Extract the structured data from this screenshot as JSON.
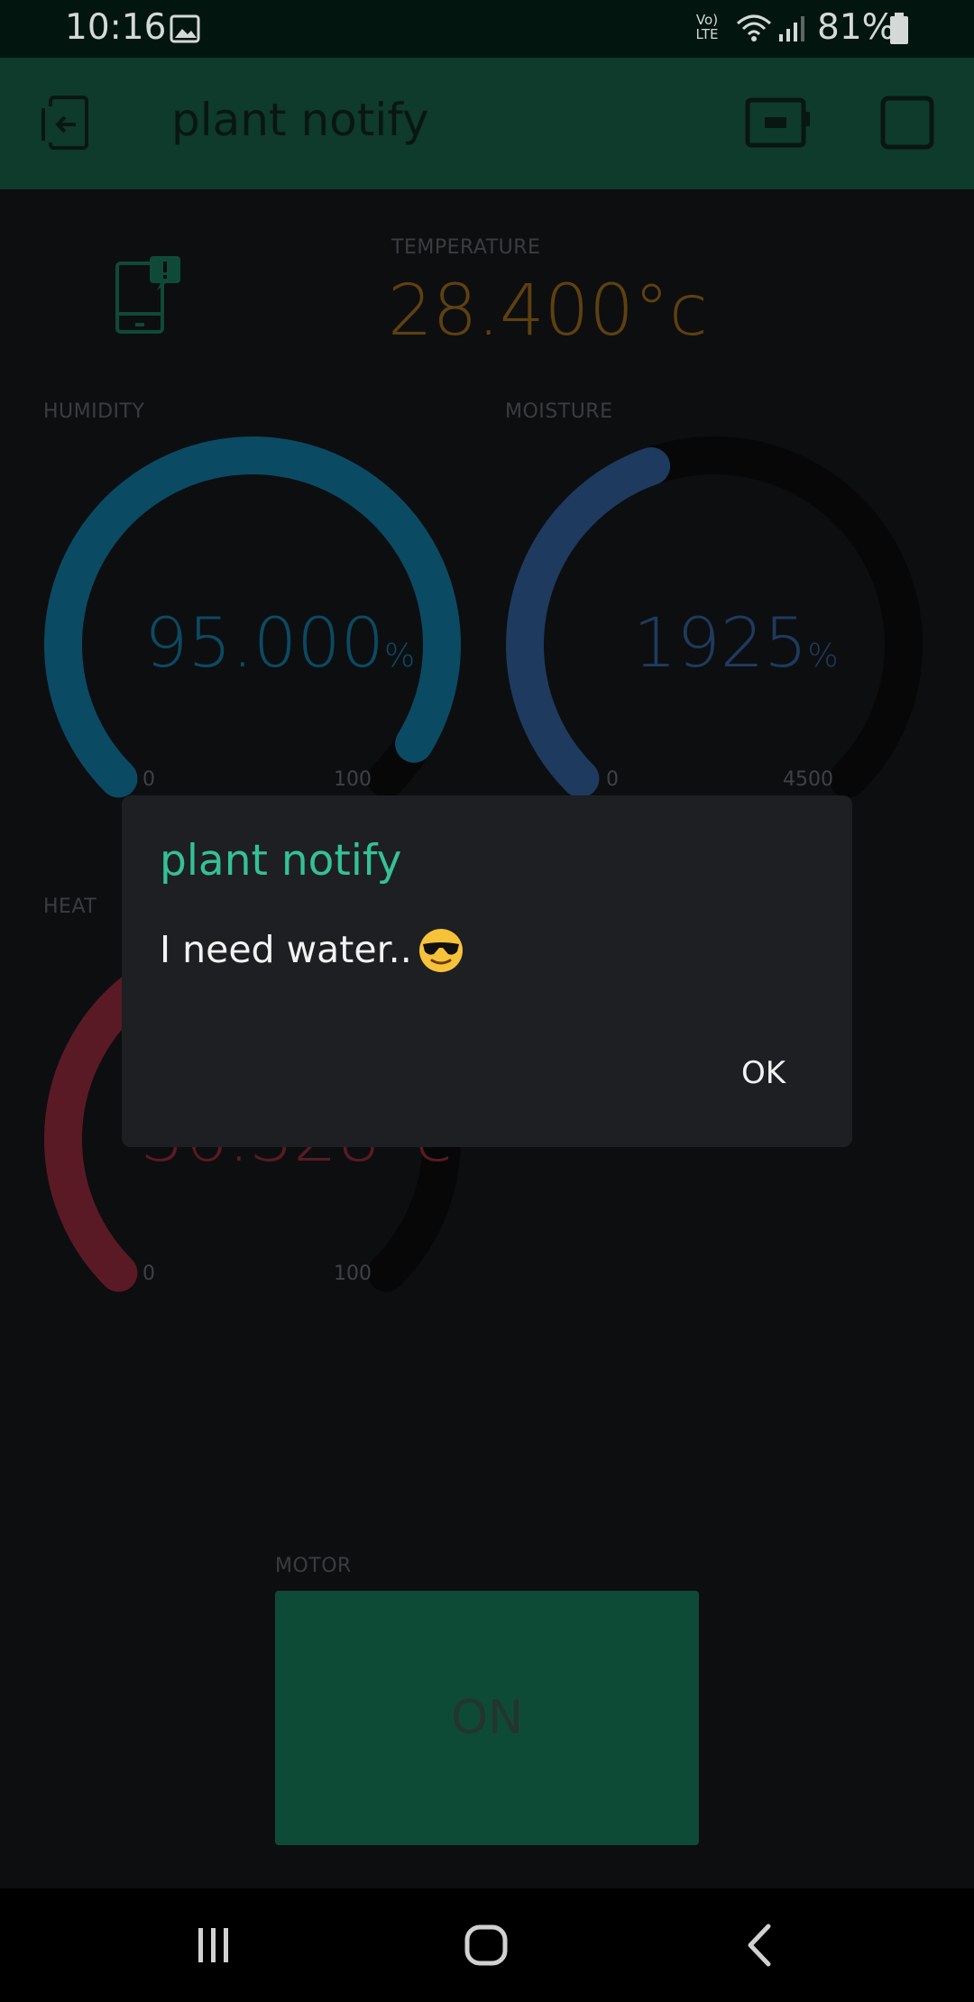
{
  "status_bar": {
    "time": "10:16",
    "volte": "Vo) LTE",
    "battery_percent": "81%"
  },
  "app_bar": {
    "title": "plant notify"
  },
  "temperature": {
    "label": "TEMPERATURE",
    "value": "28.400°c"
  },
  "humidity": {
    "label": "HUMIDITY",
    "value": "95.000",
    "unit": "%",
    "min": "0",
    "max": "100",
    "fraction": 0.95
  },
  "moisture": {
    "label": "MOISTURE",
    "value": "1925",
    "unit": "%",
    "min": "0",
    "max": "4500",
    "fraction": 0.428
  },
  "heat": {
    "label": "HEAT",
    "value": "36.328°c",
    "min": "0",
    "max": "100",
    "fraction": 0.36
  },
  "motor": {
    "label": "MOTOR",
    "button": "ON"
  },
  "dialog": {
    "title": "plant notify",
    "message": "I need water..",
    "ok": "OK"
  },
  "colors": {
    "humidity": "#0b4a63",
    "moisture": "#1e3a5e",
    "heat": "#5a1a25",
    "temperature": "#5f4010",
    "accent": "#34c196"
  }
}
